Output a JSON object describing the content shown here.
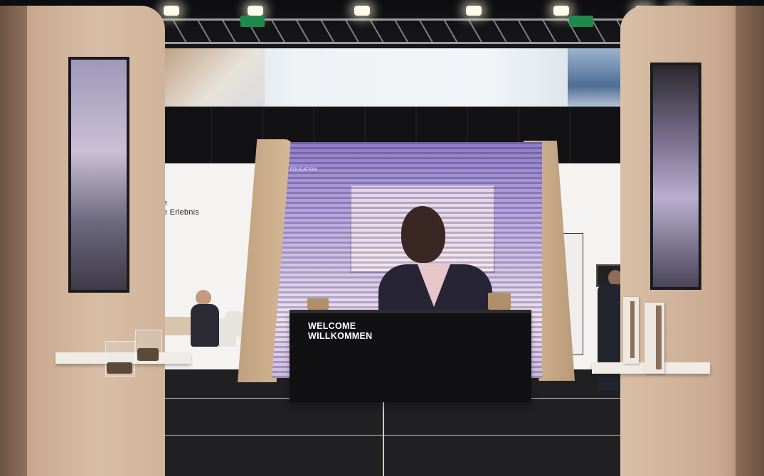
{
  "wall_text": {
    "line1": "e",
    "line2": "e Erlebnis"
  },
  "led_screen": {
    "caption": "EDUCATION"
  },
  "counter": {
    "line1": "WELCOME",
    "line2": "WILLKOMMEN"
  },
  "colors": {
    "wood": "#d5b996",
    "counter": "#111113",
    "led_purple": "#b7a6e0",
    "back_wall": "#f4f3f1"
  }
}
